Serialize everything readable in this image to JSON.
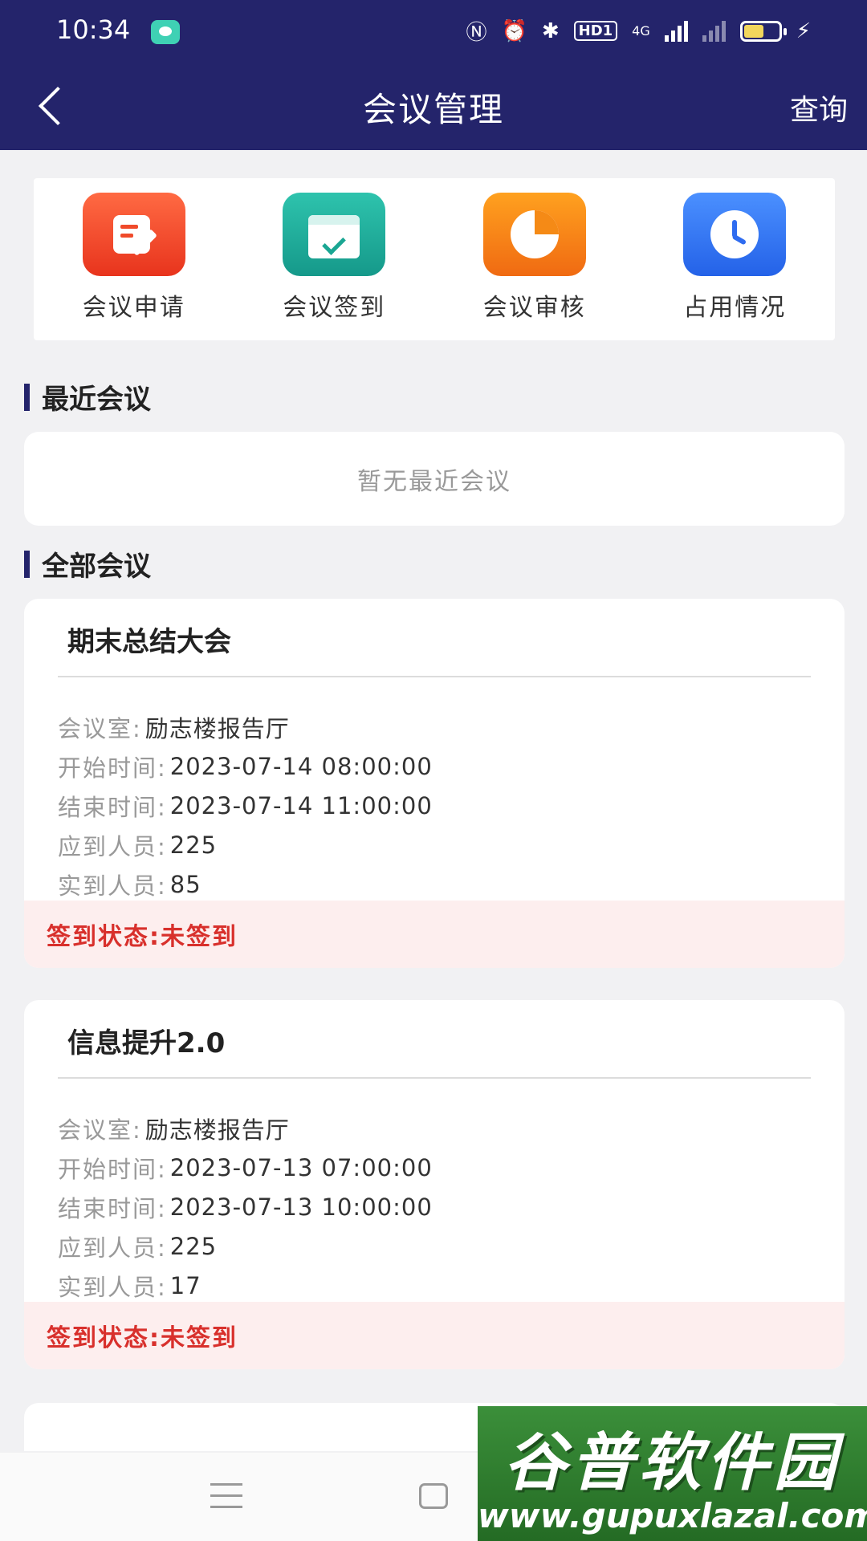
{
  "status_bar": {
    "time": "10:34",
    "hd_label": "HD1",
    "network_label": "4G",
    "icons": [
      "chat-notification-icon",
      "nfc-icon",
      "alarm-icon",
      "bluetooth-icon",
      "signal-icon",
      "battery-icon",
      "charging-icon"
    ]
  },
  "header": {
    "title": "会议管理",
    "query_label": "查询"
  },
  "quick_menu": [
    {
      "label": "会议申请",
      "icon": "edit-icon"
    },
    {
      "label": "会议签到",
      "icon": "calendar-check-icon"
    },
    {
      "label": "会议审核",
      "icon": "pie-chart-icon"
    },
    {
      "label": "占用情况",
      "icon": "clock-icon"
    }
  ],
  "recent": {
    "title": "最近会议",
    "empty_text": "暂无最近会议"
  },
  "all": {
    "title": "全部会议",
    "meetings": [
      {
        "title": "期末总结大会",
        "room_label": "会议室:",
        "room": "励志楼报告厅",
        "start_label": "开始时间:",
        "start": "2023-07-14 08:00:00",
        "end_label": "结束时间:",
        "end": "2023-07-14 11:00:00",
        "expected_label": "应到人员:",
        "expected": "225",
        "actual_label": "实到人员:",
        "actual": "85",
        "status_label": "签到状态:",
        "status": "未签到"
      },
      {
        "title": "信息提升2.0",
        "room_label": "会议室:",
        "room": "励志楼报告厅",
        "start_label": "开始时间:",
        "start": "2023-07-13 07:00:00",
        "end_label": "结束时间:",
        "end": "2023-07-13 10:00:00",
        "expected_label": "应到人员:",
        "expected": "225",
        "actual_label": "实到人员:",
        "actual": "17",
        "status_label": "签到状态:",
        "status": "未签到"
      }
    ]
  },
  "watermark": {
    "cn": "谷普软件园",
    "url": "www.gupuxlazal.com"
  },
  "colors": {
    "header_bg": "#24246b",
    "status_red": "#d8302c",
    "status_bg": "#fdeeee"
  }
}
